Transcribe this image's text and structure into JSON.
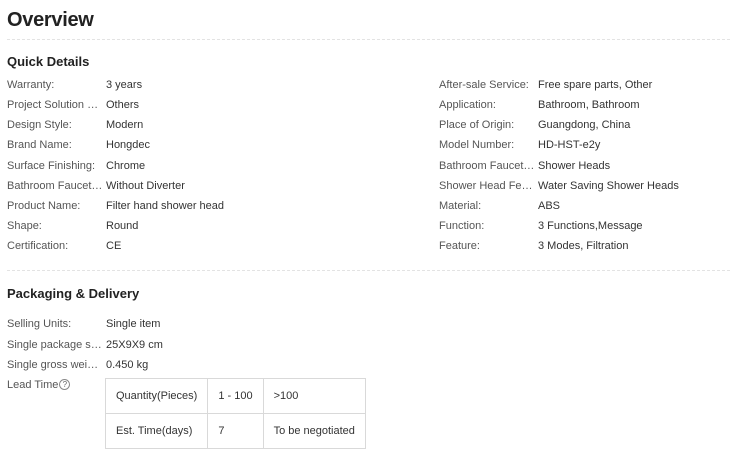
{
  "overview": {
    "title": "Overview"
  },
  "quick_details": {
    "title": "Quick Details",
    "left": [
      {
        "key": "Warranty:",
        "value": "3 years"
      },
      {
        "key": "Project Solution Capability:",
        "value": "Others"
      },
      {
        "key": "Design Style:",
        "value": "Modern"
      },
      {
        "key": "Brand Name:",
        "value": "Hongdec"
      },
      {
        "key": "Surface Finishing:",
        "value": "Chrome"
      },
      {
        "key": "Bathroom Faucet Style:",
        "value": "Without Diverter"
      },
      {
        "key": "Product Name:",
        "value": "Filter hand shower head"
      },
      {
        "key": "Shape:",
        "value": "Round"
      },
      {
        "key": "Certification:",
        "value": "CE"
      }
    ],
    "right": [
      {
        "key": "After-sale Service:",
        "value": "Free spare parts, Other"
      },
      {
        "key": "Application:",
        "value": "Bathroom, Bathroom"
      },
      {
        "key": "Place of Origin:",
        "value": "Guangdong, China"
      },
      {
        "key": "Model Number:",
        "value": "HD-HST-e2y"
      },
      {
        "key": "Bathroom Faucet Accessories:",
        "value": "Shower Heads"
      },
      {
        "key": "Shower Head Feature:",
        "value": "Water Saving Shower Heads"
      },
      {
        "key": "Material:",
        "value": "ABS"
      },
      {
        "key": "Function:",
        "value": "3 Functions,Message"
      },
      {
        "key": "Feature:",
        "value": "3 Modes, Filtration"
      }
    ]
  },
  "packaging": {
    "title": "Packaging & Delivery",
    "items": [
      {
        "key": "Selling Units:",
        "value": "Single item"
      },
      {
        "key": "Single package size:",
        "value": "25X9X9 cm"
      },
      {
        "key": "Single gross weight:",
        "value": "0.450 kg"
      }
    ],
    "lead_time_label": "Lead Time",
    "help_icon": "?",
    "lead_table": {
      "row1": [
        "Quantity(Pieces)",
        "1 - 100",
        ">100"
      ],
      "row2": [
        "Est. Time(days)",
        "7",
        "To be negotiated"
      ]
    }
  }
}
